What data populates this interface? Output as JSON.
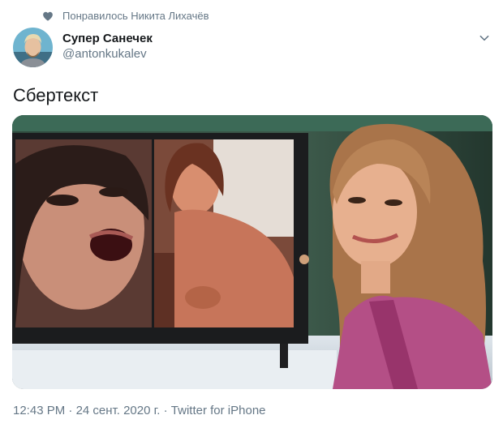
{
  "liked_by": {
    "text": "Понравилось Никита Лихачёв",
    "icon": "heart-icon"
  },
  "author": {
    "display_name": "Супер Санечек",
    "handle": "@antonkukalev",
    "avatar_icon": "avatar"
  },
  "tweet": {
    "text": "Сбертекст"
  },
  "meta": {
    "time": "12:43 PM",
    "separator": "·",
    "date": "24 сент. 2020 г.",
    "source": "Twitter for iPhone"
  },
  "colors": {
    "secondary_text": "#657786",
    "primary_text": "#14171a"
  }
}
